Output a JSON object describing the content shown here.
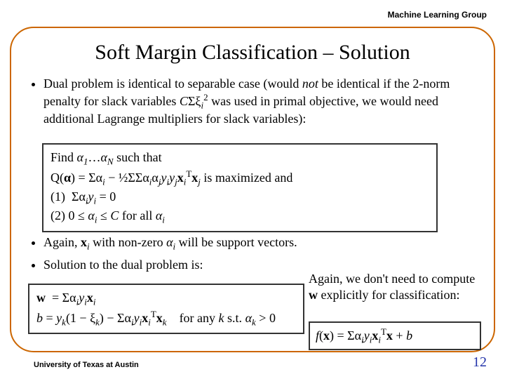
{
  "header": {
    "group": "Machine Learning Group"
  },
  "footer": {
    "affiliation": "University of Texas at Austin",
    "page": "12"
  },
  "title": "Soft Margin Classification – Solution",
  "bullets1": [
    "Dual problem is identical to separable case (would __i_not__ be identical if the 2-norm penalty for slack variables __m_CΣξ_i^2__ was used in primal objective, we would need additional Lagrange multipliers for slack variables):"
  ],
  "box1": {
    "l1a": "Find ",
    "l1b": "α",
    "l1c": "…",
    "l1d": "α",
    "l1e": " such that",
    "l2": "Q(α) = Σα_i − ½ΣΣα_i α_j y_i y_j x_i^T x_j  is maximized and",
    "l3": "(1)  Σα_i y_i = 0",
    "l4a": "(2)  0 ≤ ",
    "l4b": "α",
    "l4c": " ≤ C for all ",
    "l4d": "α"
  },
  "bullets2": [
    "Again, __b_x____sub_i__ with non-zero __i_α____sub_i__ will be support vectors.",
    "Solution to the dual problem is:"
  ],
  "box2": {
    "l1": "w  = Σα_i y_i x_i",
    "l2": "b = y_k(1 − ξ_k) − Σα_i y_i x_i^T x_k    for any k s.t. α_k > 0"
  },
  "aside": {
    "l1": "Again, we don't need to compute ",
    "l2": "w",
    "l3": " explicitly for classification:"
  },
  "box3": {
    "l1": "f(x) = Σα_i y_i x_i^T x + b"
  }
}
